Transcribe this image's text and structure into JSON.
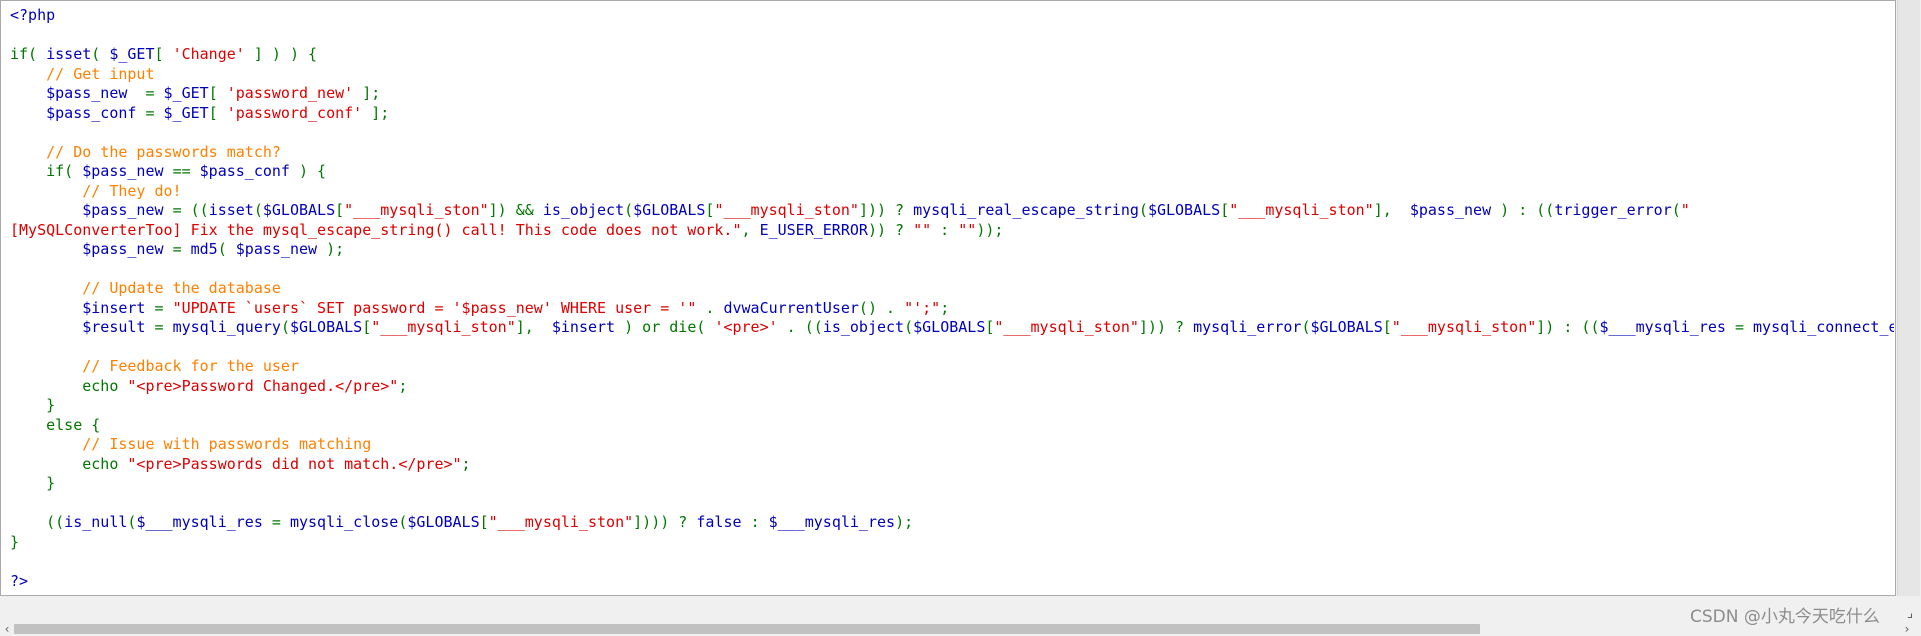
{
  "code_lines": [
    [
      {
        "c": "b",
        "t": "<?php"
      }
    ],
    [],
    [
      {
        "c": "g",
        "t": "if( "
      },
      {
        "c": "b",
        "t": "isset"
      },
      {
        "c": "g",
        "t": "( "
      },
      {
        "c": "b",
        "t": "$_GET"
      },
      {
        "c": "g",
        "t": "[ "
      },
      {
        "c": "r",
        "t": "'Change'"
      },
      {
        "c": "g",
        "t": " ] ) ) {"
      }
    ],
    [
      {
        "c": "o",
        "t": "    // Get input"
      }
    ],
    [
      {
        "c": "b",
        "t": "    $pass_new  "
      },
      {
        "c": "g",
        "t": "= "
      },
      {
        "c": "b",
        "t": "$_GET"
      },
      {
        "c": "g",
        "t": "[ "
      },
      {
        "c": "r",
        "t": "'password_new'"
      },
      {
        "c": "g",
        "t": " ];"
      }
    ],
    [
      {
        "c": "b",
        "t": "    $pass_conf "
      },
      {
        "c": "g",
        "t": "= "
      },
      {
        "c": "b",
        "t": "$_GET"
      },
      {
        "c": "g",
        "t": "[ "
      },
      {
        "c": "r",
        "t": "'password_conf'"
      },
      {
        "c": "g",
        "t": " ];"
      }
    ],
    [],
    [
      {
        "c": "o",
        "t": "    // Do the passwords match?"
      }
    ],
    [
      {
        "c": "g",
        "t": "    if( "
      },
      {
        "c": "b",
        "t": "$pass_new "
      },
      {
        "c": "g",
        "t": "== "
      },
      {
        "c": "b",
        "t": "$pass_conf "
      },
      {
        "c": "g",
        "t": ") {"
      }
    ],
    [
      {
        "c": "o",
        "t": "        // They do!"
      }
    ],
    [
      {
        "c": "b",
        "t": "        $pass_new "
      },
      {
        "c": "g",
        "t": "= (("
      },
      {
        "c": "b",
        "t": "isset"
      },
      {
        "c": "g",
        "t": "("
      },
      {
        "c": "b",
        "t": "$GLOBALS"
      },
      {
        "c": "g",
        "t": "["
      },
      {
        "c": "r",
        "t": "\"___mysqli_ston\""
      },
      {
        "c": "g",
        "t": "]) && "
      },
      {
        "c": "b",
        "t": "is_object"
      },
      {
        "c": "g",
        "t": "("
      },
      {
        "c": "b",
        "t": "$GLOBALS"
      },
      {
        "c": "g",
        "t": "["
      },
      {
        "c": "r",
        "t": "\"___mysqli_ston\""
      },
      {
        "c": "g",
        "t": "])) ? "
      },
      {
        "c": "b",
        "t": "mysqli_real_escape_string"
      },
      {
        "c": "g",
        "t": "("
      },
      {
        "c": "b",
        "t": "$GLOBALS"
      },
      {
        "c": "g",
        "t": "["
      },
      {
        "c": "r",
        "t": "\"___mysqli_ston\""
      },
      {
        "c": "g",
        "t": "],  "
      },
      {
        "c": "b",
        "t": "$pass_new "
      },
      {
        "c": "g",
        "t": ") : (("
      },
      {
        "c": "b",
        "t": "trigger_error"
      },
      {
        "c": "g",
        "t": "("
      },
      {
        "c": "r",
        "t": "\""
      }
    ],
    [
      {
        "c": "r",
        "t": "[MySQLConverterToo] Fix the mysql_escape_string() call! This code does not work.\""
      },
      {
        "c": "g",
        "t": ", "
      },
      {
        "c": "b",
        "t": "E_USER_ERROR"
      },
      {
        "c": "g",
        "t": ")) ? "
      },
      {
        "c": "r",
        "t": "\"\""
      },
      {
        "c": "g",
        "t": " : "
      },
      {
        "c": "r",
        "t": "\"\""
      },
      {
        "c": "g",
        "t": "));"
      }
    ],
    [
      {
        "c": "b",
        "t": "        $pass_new "
      },
      {
        "c": "g",
        "t": "= "
      },
      {
        "c": "b",
        "t": "md5"
      },
      {
        "c": "g",
        "t": "( "
      },
      {
        "c": "b",
        "t": "$pass_new "
      },
      {
        "c": "g",
        "t": ");"
      }
    ],
    [],
    [
      {
        "c": "o",
        "t": "        // Update the database"
      }
    ],
    [
      {
        "c": "b",
        "t": "        $insert "
      },
      {
        "c": "g",
        "t": "= "
      },
      {
        "c": "r",
        "t": "\"UPDATE `users` SET password = '$pass_new' WHERE user = '\""
      },
      {
        "c": "g",
        "t": " . "
      },
      {
        "c": "b",
        "t": "dvwaCurrentUser"
      },
      {
        "c": "g",
        "t": "() . "
      },
      {
        "c": "r",
        "t": "\"';\""
      },
      {
        "c": "g",
        "t": ";"
      }
    ],
    [
      {
        "c": "b",
        "t": "        $result "
      },
      {
        "c": "g",
        "t": "= "
      },
      {
        "c": "b",
        "t": "mysqli_query"
      },
      {
        "c": "g",
        "t": "("
      },
      {
        "c": "b",
        "t": "$GLOBALS"
      },
      {
        "c": "g",
        "t": "["
      },
      {
        "c": "r",
        "t": "\"___mysqli_ston\""
      },
      {
        "c": "g",
        "t": "],  "
      },
      {
        "c": "b",
        "t": "$insert "
      },
      {
        "c": "g",
        "t": ") or die( "
      },
      {
        "c": "r",
        "t": "'<pre>'"
      },
      {
        "c": "g",
        "t": " . (("
      },
      {
        "c": "b",
        "t": "is_object"
      },
      {
        "c": "g",
        "t": "("
      },
      {
        "c": "b",
        "t": "$GLOBALS"
      },
      {
        "c": "g",
        "t": "["
      },
      {
        "c": "r",
        "t": "\"___mysqli_ston\""
      },
      {
        "c": "g",
        "t": "])) ? "
      },
      {
        "c": "b",
        "t": "mysqli_error"
      },
      {
        "c": "g",
        "t": "("
      },
      {
        "c": "b",
        "t": "$GLOBALS"
      },
      {
        "c": "g",
        "t": "["
      },
      {
        "c": "r",
        "t": "\"___mysqli_ston\""
      },
      {
        "c": "g",
        "t": "]) : (("
      },
      {
        "c": "b",
        "t": "$___mysqli_res "
      },
      {
        "c": "g",
        "t": "= "
      },
      {
        "c": "b",
        "t": "mysqli_connect_error"
      }
    ],
    [],
    [
      {
        "c": "o",
        "t": "        // Feedback for the user"
      }
    ],
    [
      {
        "c": "g",
        "t": "        echo "
      },
      {
        "c": "r",
        "t": "\"<pre>Password Changed.</pre>\""
      },
      {
        "c": "g",
        "t": ";"
      }
    ],
    [
      {
        "c": "g",
        "t": "    }"
      }
    ],
    [
      {
        "c": "g",
        "t": "    else {"
      }
    ],
    [
      {
        "c": "o",
        "t": "        // Issue with passwords matching"
      }
    ],
    [
      {
        "c": "g",
        "t": "        echo "
      },
      {
        "c": "r",
        "t": "\"<pre>Passwords did not match.</pre>\""
      },
      {
        "c": "g",
        "t": ";"
      }
    ],
    [
      {
        "c": "g",
        "t": "    }"
      }
    ],
    [],
    [
      {
        "c": "g",
        "t": "    (("
      },
      {
        "c": "b",
        "t": "is_null"
      },
      {
        "c": "g",
        "t": "("
      },
      {
        "c": "b",
        "t": "$___mysqli_res "
      },
      {
        "c": "g",
        "t": "= "
      },
      {
        "c": "b",
        "t": "mysqli_close"
      },
      {
        "c": "g",
        "t": "("
      },
      {
        "c": "b",
        "t": "$GLOBALS"
      },
      {
        "c": "g",
        "t": "["
      },
      {
        "c": "r",
        "t": "\"___mysqli_ston\""
      },
      {
        "c": "g",
        "t": "]))) ? "
      },
      {
        "c": "b",
        "t": "false "
      },
      {
        "c": "g",
        "t": ": "
      },
      {
        "c": "b",
        "t": "$___mysqli_res"
      },
      {
        "c": "g",
        "t": ");"
      }
    ],
    [
      {
        "c": "g",
        "t": "}"
      }
    ],
    [],
    [
      {
        "c": "b",
        "t": "?>"
      }
    ]
  ],
  "colors": {
    "b": "#0000bb",
    "g": "#007700",
    "r": "#dd0000",
    "o": "#ff8000"
  },
  "scrollbar": {
    "left_arrow": "‹",
    "right_arrow": "›",
    "thumb_fraction": 0.78
  },
  "resize_grip": "⌟",
  "watermark": "CSDN @小丸今天吃什么"
}
